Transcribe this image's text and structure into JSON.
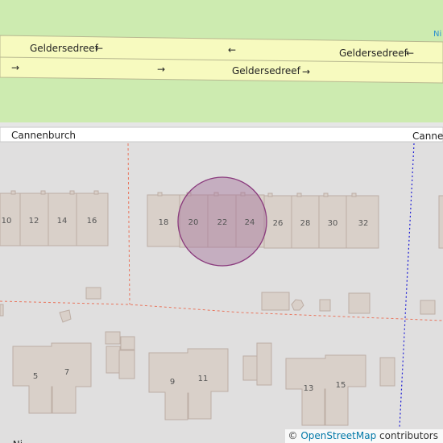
{
  "map": {
    "streets": {
      "geldersedreef_1": "Geldersedreef",
      "geldersedreef_2": "Geldersedreef",
      "geldersedreef_3": "Geldersedreef",
      "cannenburch_left": "Cannenburch",
      "cannenburch_right": "Cannenburch",
      "bottom_partial": "Ni"
    },
    "corner_label": "Ni",
    "house_numbers": {
      "n10": "10",
      "n12": "12",
      "n14": "14",
      "n16": "16",
      "n18": "18",
      "n20": "20",
      "n22": "22",
      "n24": "24",
      "n26": "26",
      "n28": "28",
      "n30": "30",
      "n32": "32",
      "n5": "5",
      "n7": "7",
      "n9": "9",
      "n11": "11",
      "n13": "13",
      "n15": "15"
    },
    "arrows": {
      "left": "←",
      "right": "→"
    },
    "colors": {
      "grass": "#cdebb0",
      "road": "#f7fabf",
      "building": "#d9d0c9",
      "building_stroke": "#bdaea5",
      "highlight": "#a3749b",
      "boundary": "#e8755d",
      "footpath": "#1f1fd6"
    }
  },
  "attribution": {
    "copyright": "©",
    "link_text": "OpenStreetMap",
    "suffix": "contributors"
  }
}
